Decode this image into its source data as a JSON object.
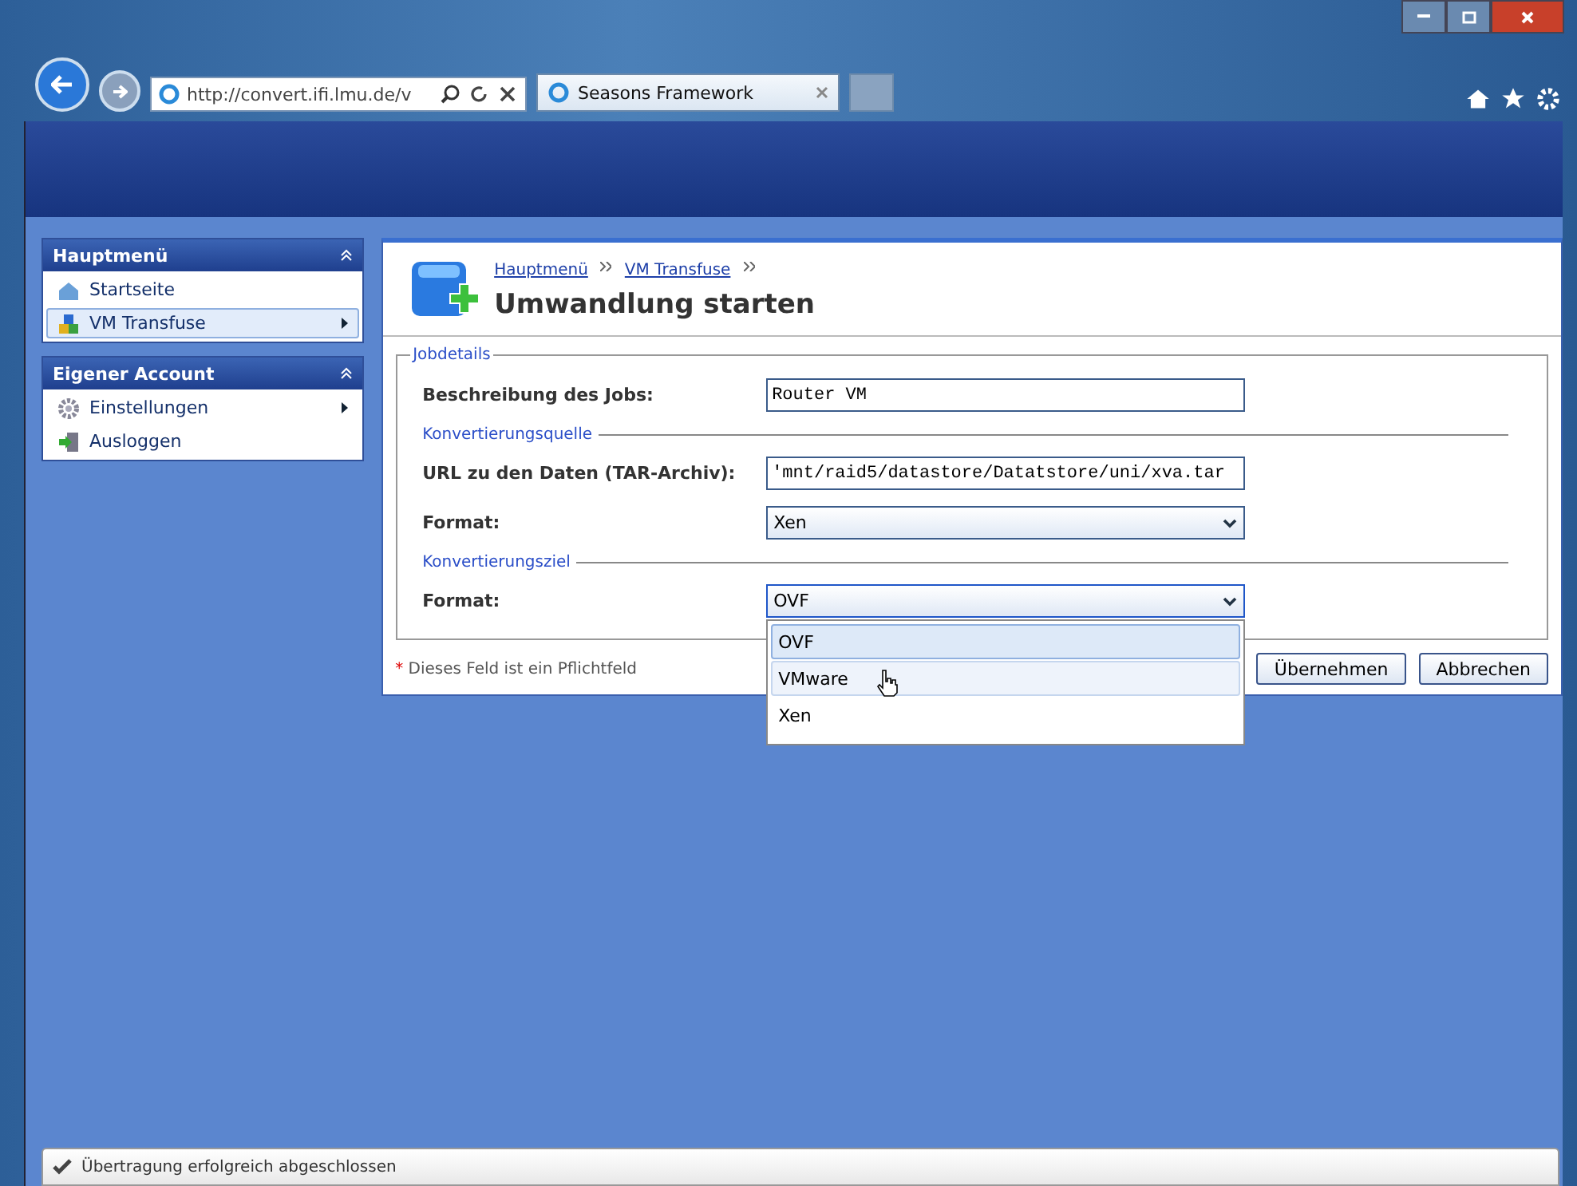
{
  "browser": {
    "address": "http://convert.ifi.lmu.de/v",
    "tabs": [
      {
        "label": "Seasons Framework",
        "selected": true
      }
    ]
  },
  "sidebar": [
    {
      "title": "Hauptmenü",
      "items": [
        {
          "label": "Startseite",
          "submenu": false,
          "selected": false
        },
        {
          "label": "VM Transfuse",
          "submenu": true,
          "selected": true
        }
      ]
    },
    {
      "title": "Eigener Account",
      "items": [
        {
          "label": "Einstellungen",
          "submenu": true,
          "selected": false
        },
        {
          "label": "Ausloggen",
          "submenu": false,
          "selected": false
        }
      ]
    }
  ],
  "breadcrumb": [
    "Hauptmenü",
    "VM Transfuse"
  ],
  "page_title": "Umwandlung starten",
  "form": {
    "legend": "Jobdetails",
    "rows": [
      {
        "kind": "input",
        "label": "Beschreibung des Jobs:",
        "value": "Router VM"
      },
      {
        "kind": "section",
        "label": "Konvertierungsquelle"
      },
      {
        "kind": "input",
        "label": "URL zu den Daten (TAR-Archiv):",
        "value": "'mnt/raid5/datastore/Datatstore/uni/xva.tar"
      },
      {
        "kind": "select",
        "label": "Format:",
        "value": "Xen",
        "open": false
      },
      {
        "kind": "section",
        "label": "Konvertierungsziel"
      },
      {
        "kind": "select",
        "label": "Format:",
        "value": "OVF",
        "open": true,
        "options": [
          {
            "label": "OVF",
            "selected": true,
            "hover": false
          },
          {
            "label": "VMware",
            "selected": false,
            "hover": true
          },
          {
            "label": "Xen",
            "selected": false,
            "hover": false
          }
        ]
      }
    ]
  },
  "required_note": {
    "mark": "*",
    "text": "Dieses Feld ist ein Pflichtfeld"
  },
  "buttons": [
    "Übernehmen",
    "Abbrechen"
  ],
  "status": "Übertragung erfolgreich abgeschlossen"
}
